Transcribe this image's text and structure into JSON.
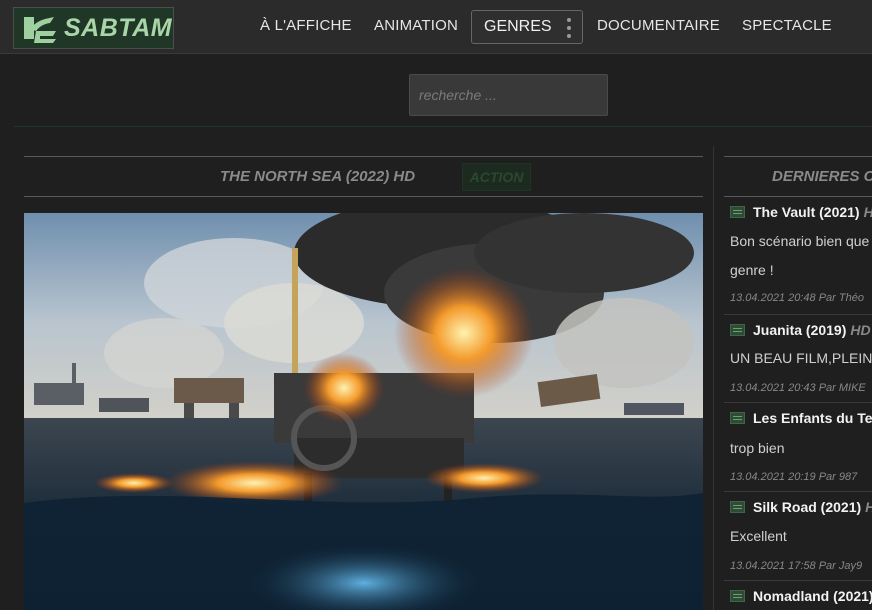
{
  "header": {
    "logo_text": "SABTAM",
    "nav": [
      {
        "label": "À L'AFFICHE"
      },
      {
        "label": "ANIMATION"
      },
      {
        "label": "GENRES"
      },
      {
        "label": "DOCUMENTAIRE"
      },
      {
        "label": "SPECTACLE"
      }
    ]
  },
  "search": {
    "placeholder": "recherche ..."
  },
  "article": {
    "title": "THE NORTH SEA (2022) HD",
    "genre": "ACTION"
  },
  "sidebar": {
    "title": "DERNIERES C",
    "comments": [
      {
        "film": "The Vault (2021)",
        "quality": "H",
        "text1": "Bon scénario bien que",
        "text2": "genre !",
        "meta": "13.04.2021 20:48 Par Théo"
      },
      {
        "film": "Juanita (2019)",
        "quality": "HD",
        "text1": "UN BEAU FILM,PLEIN",
        "text2": "",
        "meta": "13.04.2021 20:43 Par MIKE"
      },
      {
        "film": "Les Enfants du Te",
        "quality": "",
        "text1": "trop bien",
        "text2": "",
        "meta": "13.04.2021 20:19 Par 987"
      },
      {
        "film": "Silk Road (2021)",
        "quality": "H",
        "text1": "Excellent",
        "text2": "",
        "meta": "13.04.2021 17:58 Par Jay9"
      },
      {
        "film": "Nomadland (2021)",
        "quality": "",
        "text1": "",
        "text2": "",
        "meta": ""
      }
    ]
  },
  "colors": {
    "accent": "#a9d6a9",
    "logo_bg": "#203626",
    "page_bg": "#1f1f1f"
  }
}
